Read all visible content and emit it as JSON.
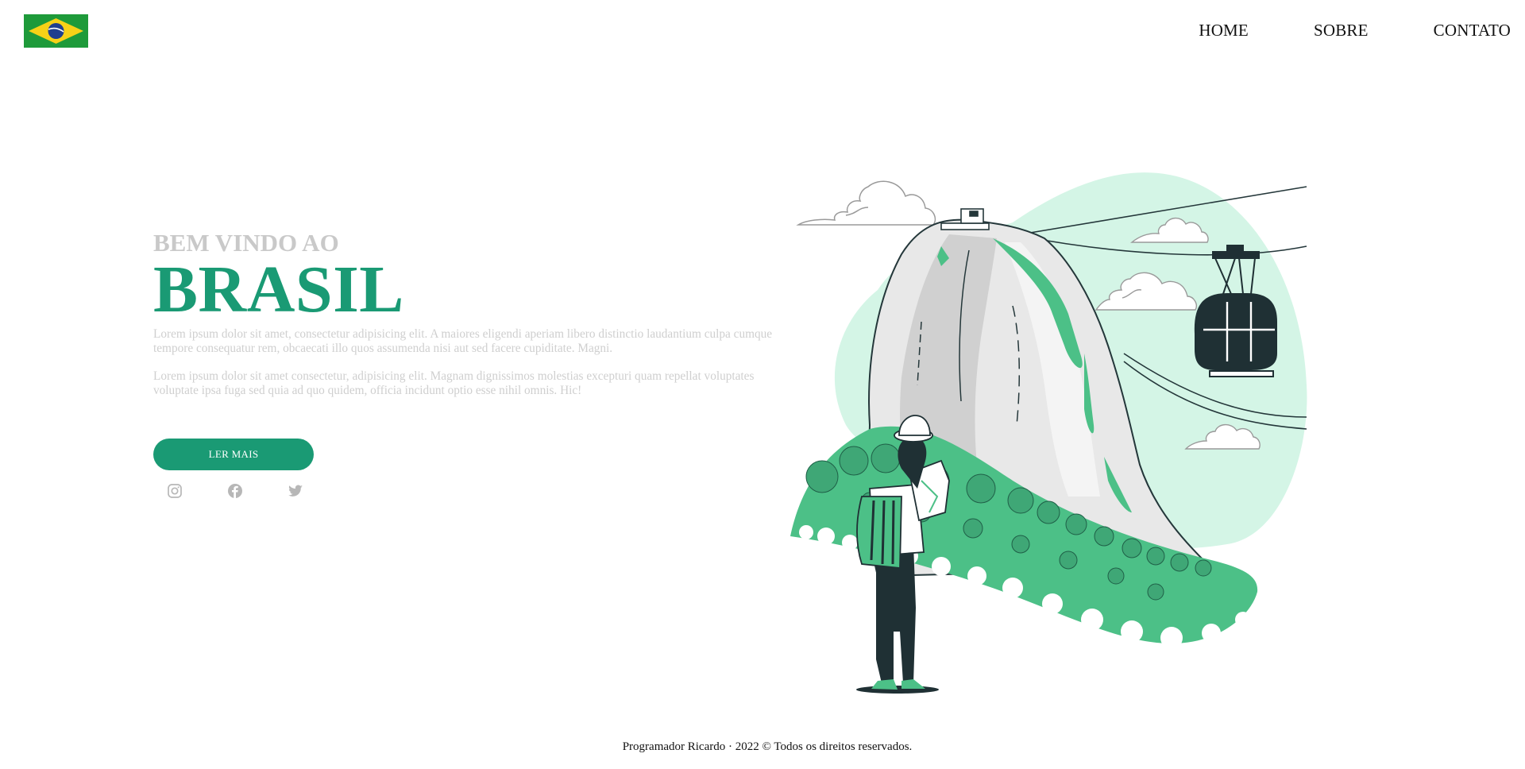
{
  "header": {
    "logo_name": "brazil-flag",
    "nav": [
      {
        "label": "HOME"
      },
      {
        "label": "SOBRE"
      },
      {
        "label": "CONTATO"
      }
    ]
  },
  "hero": {
    "welcome": "BEM VINDO AO",
    "title": "BRASIL",
    "paragraphs": [
      "Lorem ipsum dolor sit amet, consectetur adipisicing elit. A maiores eligendi aperiam libero distinctio laudantium culpa cumque tempore consequatur rem, obcaecati illo quos assumenda nisi aut sed facere cupiditate. Magni.",
      "Lorem ipsum dolor sit amet consectetur, adipisicing elit. Magnam dignissimos molestias excepturi quam repellat voluptates voluptate ipsa fuga sed quia ad quo quidem, officia incidunt optio esse nihil omnis. Hic!"
    ],
    "button_label": "LER MAIS"
  },
  "socials": [
    {
      "icon": "instagram-icon"
    },
    {
      "icon": "facebook-icon"
    },
    {
      "icon": "twitter-icon"
    }
  ],
  "footer": {
    "text": "Programador Ricardo · 2022 © Todos os direitos reservados."
  },
  "colors": {
    "accent": "#1a9a74",
    "muted_text": "#c9c9c9",
    "illustration_green": "#4cc087",
    "illustration_mint": "#d4f5e6",
    "illustration_dark": "#1f3034"
  }
}
